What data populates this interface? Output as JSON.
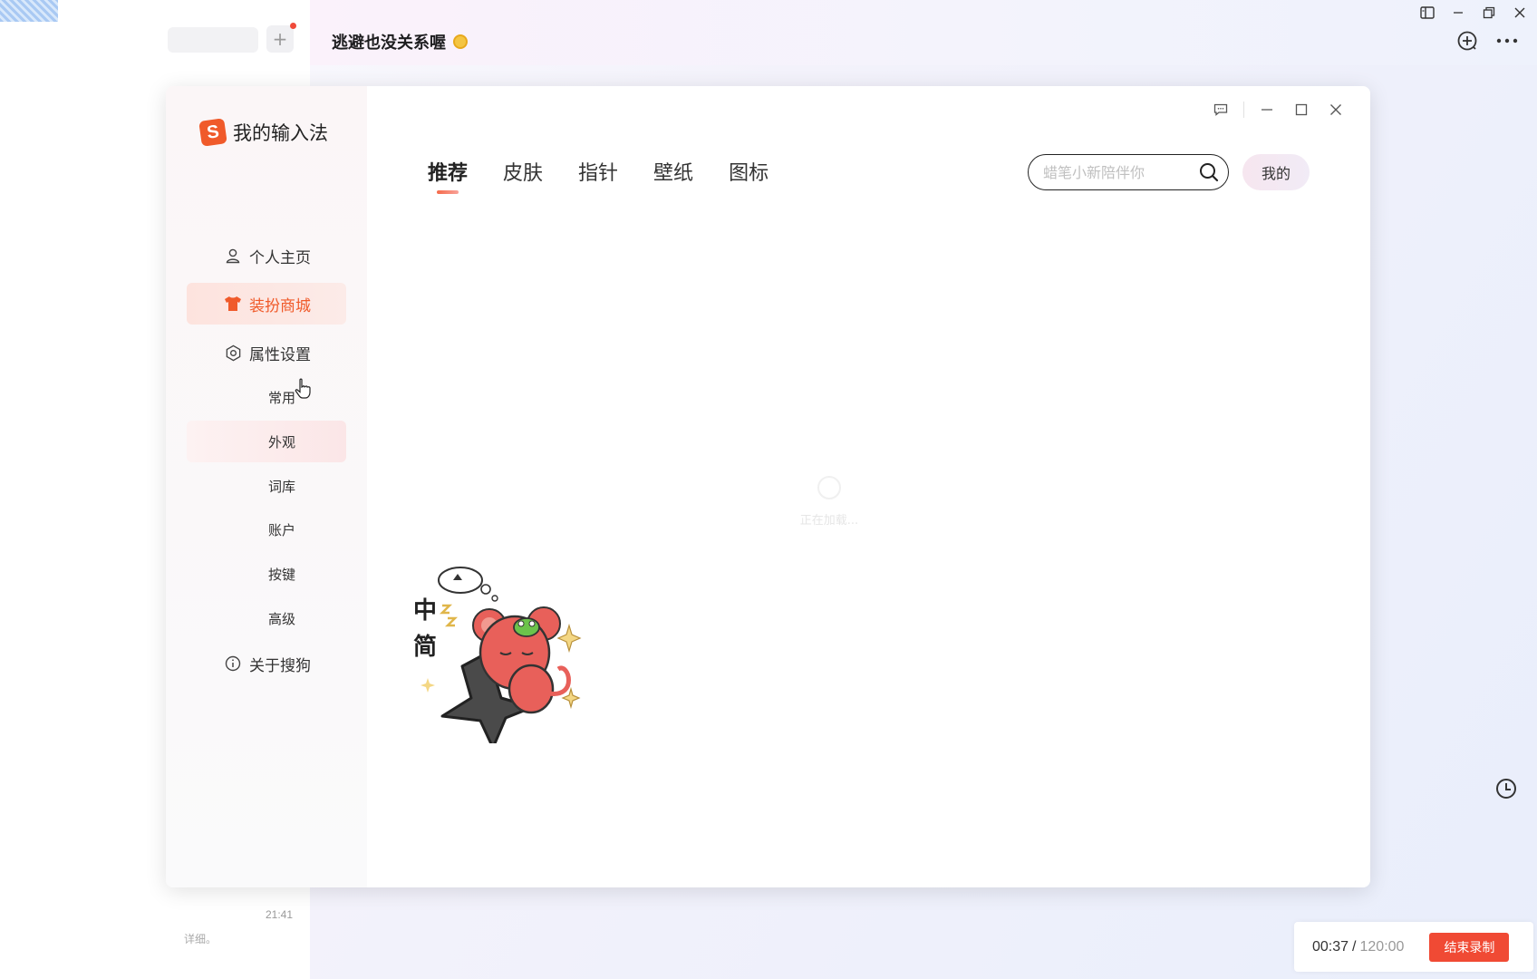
{
  "chat": {
    "title": "逃避也没关系喔",
    "last_time": "21:41",
    "preview": "详细。"
  },
  "recorder": {
    "elapsed": "00:37",
    "separator": "/",
    "total": "120:00",
    "stop_label": "结束录制"
  },
  "ime": {
    "brand": "我的输入法",
    "nav": {
      "profile": "个人主页",
      "store": "装扮商城",
      "settings": "属性设置",
      "about": "关于搜狗"
    },
    "sub": [
      "常用",
      "外观",
      "词库",
      "账户",
      "按键",
      "高级"
    ],
    "tabs": [
      "推荐",
      "皮肤",
      "指针",
      "壁纸",
      "图标"
    ],
    "search_placeholder": "蜡笔小新陪伴你",
    "mine_label": "我的",
    "loading_text": "正在加载...",
    "mascot_text": [
      "中",
      "简"
    ]
  },
  "colors": {
    "accent": "#f05a2a",
    "record_red": "#f04a34"
  }
}
